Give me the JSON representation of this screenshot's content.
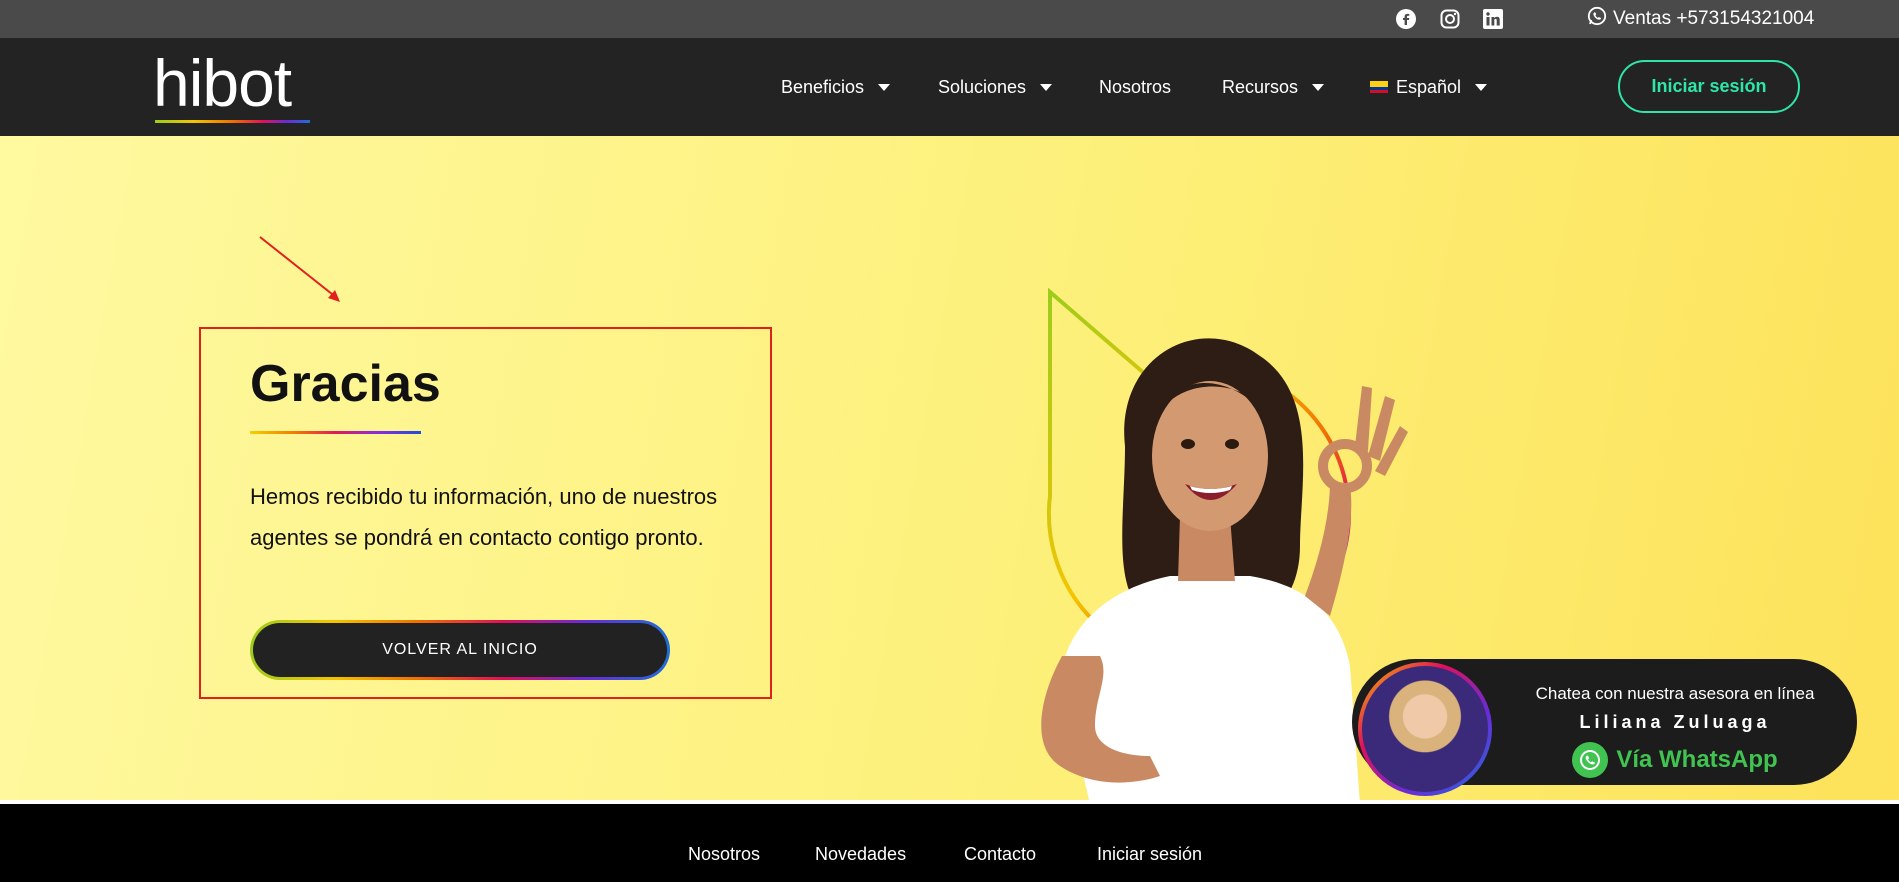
{
  "topbar": {
    "icons": [
      "facebook-icon",
      "instagram-icon",
      "linkedin-icon",
      "whatsapp-icon"
    ],
    "phone": "Ventas +573154321004"
  },
  "nav": {
    "logo": "hibot",
    "items": [
      {
        "label": "Beneficios",
        "dropdown": true
      },
      {
        "label": "Soluciones",
        "dropdown": true
      },
      {
        "label": "Nosotros",
        "dropdown": false
      },
      {
        "label": "Recursos",
        "dropdown": true
      },
      {
        "label": "Español",
        "dropdown": true
      }
    ],
    "login": "Iniciar sesión"
  },
  "hero": {
    "title": "Gracias",
    "message": "Hemos recibido tu información, uno de nuestros agentes se pondrá en contacto contigo pronto.",
    "button": "VOLVER AL INICIO"
  },
  "whatsapp": {
    "line1": "Chatea con nuestra asesora en línea",
    "name": "Liliana Zuluaga",
    "cta": "Vía WhatsApp"
  },
  "footer": {
    "links": [
      "Nosotros",
      "Novedades",
      "Contacto",
      "Iniciar sesión"
    ]
  },
  "colors": {
    "accent_green": "#2ee6a6",
    "whatsapp_green": "#40c351",
    "highlight_red": "#e0221c",
    "nav_bg": "#232323"
  }
}
